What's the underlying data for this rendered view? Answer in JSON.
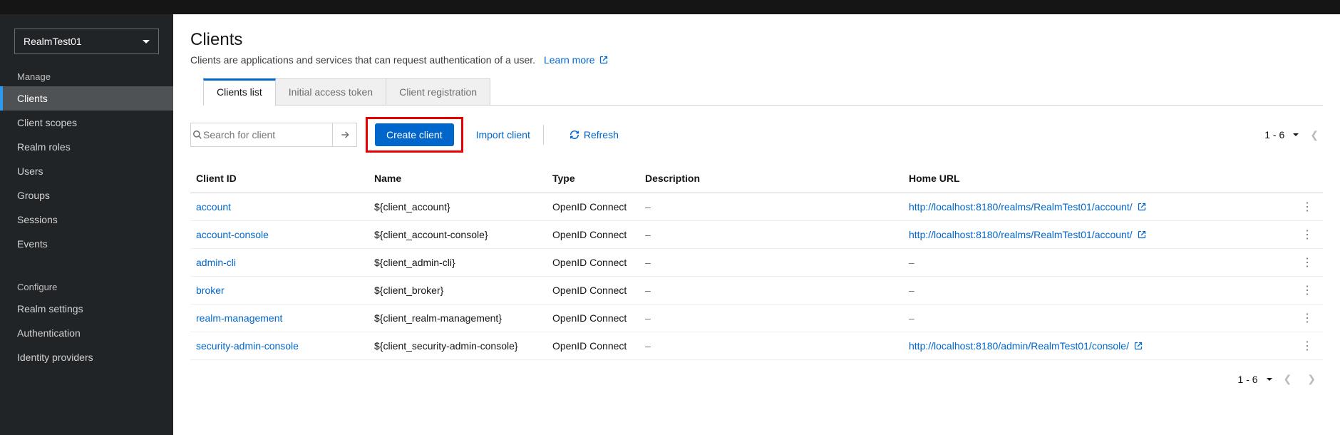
{
  "realm": {
    "selected": "RealmTest01"
  },
  "sidebar": {
    "groups": [
      {
        "title": "Manage",
        "items": [
          "Clients",
          "Client scopes",
          "Realm roles",
          "Users",
          "Groups",
          "Sessions",
          "Events"
        ]
      },
      {
        "title": "Configure",
        "items": [
          "Realm settings",
          "Authentication",
          "Identity providers"
        ]
      }
    ],
    "active": "Clients"
  },
  "page": {
    "title": "Clients",
    "description": "Clients are applications and services that can request authentication of a user.",
    "learn_more": "Learn more"
  },
  "tabs": {
    "items": [
      "Clients list",
      "Initial access token",
      "Client registration"
    ],
    "active": 0
  },
  "toolbar": {
    "search_placeholder": "Search for client",
    "create_label": "Create client",
    "import_label": "Import client",
    "refresh_label": "Refresh",
    "page_range": "1 - 6"
  },
  "table": {
    "columns": [
      "Client ID",
      "Name",
      "Type",
      "Description",
      "Home URL"
    ],
    "rows": [
      {
        "id": "account",
        "name": "${client_account}",
        "type": "OpenID Connect",
        "desc": "–",
        "url": "http://localhost:8180/realms/RealmTest01/account/"
      },
      {
        "id": "account-console",
        "name": "${client_account-console}",
        "type": "OpenID Connect",
        "desc": "–",
        "url": "http://localhost:8180/realms/RealmTest01/account/"
      },
      {
        "id": "admin-cli",
        "name": "${client_admin-cli}",
        "type": "OpenID Connect",
        "desc": "–",
        "url": "–"
      },
      {
        "id": "broker",
        "name": "${client_broker}",
        "type": "OpenID Connect",
        "desc": "–",
        "url": "–"
      },
      {
        "id": "realm-management",
        "name": "${client_realm-management}",
        "type": "OpenID Connect",
        "desc": "–",
        "url": "–"
      },
      {
        "id": "security-admin-console",
        "name": "${client_security-admin-console}",
        "type": "OpenID Connect",
        "desc": "–",
        "url": "http://localhost:8180/admin/RealmTest01/console/"
      }
    ]
  },
  "footer": {
    "page_range": "1 - 6"
  }
}
